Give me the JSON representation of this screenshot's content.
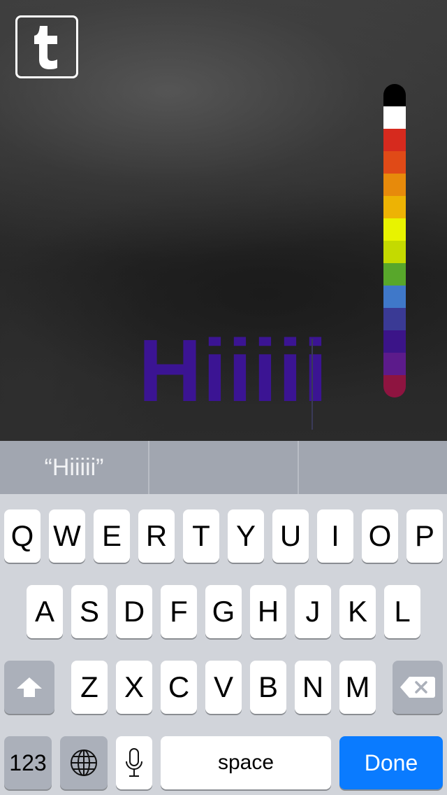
{
  "editor": {
    "caption_text": "Hiiiii",
    "caption_color": "#3b1493",
    "logo_letter": "t"
  },
  "palette": {
    "colors": [
      "#000000",
      "#ffffff",
      "#d62a1e",
      "#e04a17",
      "#e78a0b",
      "#edb304",
      "#e8f300",
      "#c4da00",
      "#58a72b",
      "#3f78c9",
      "#3a3a95",
      "#3b1488",
      "#5c1b8b",
      "#8e1440"
    ]
  },
  "predictive": {
    "suggestions": [
      "“Hiiiii”",
      "",
      ""
    ]
  },
  "keyboard": {
    "row1": [
      "Q",
      "W",
      "E",
      "R",
      "T",
      "Y",
      "U",
      "I",
      "O",
      "P"
    ],
    "row2": [
      "A",
      "S",
      "D",
      "F",
      "G",
      "H",
      "J",
      "K",
      "L"
    ],
    "row3": [
      "Z",
      "X",
      "C",
      "V",
      "B",
      "N",
      "M"
    ],
    "numbers_label": "123",
    "space_label": "space",
    "done_label": "Done",
    "shift_icon": "shift-icon",
    "delete_icon": "backspace-icon",
    "globe_icon": "globe-icon",
    "mic_icon": "microphone-icon",
    "accent_color": "#0a7bff"
  }
}
